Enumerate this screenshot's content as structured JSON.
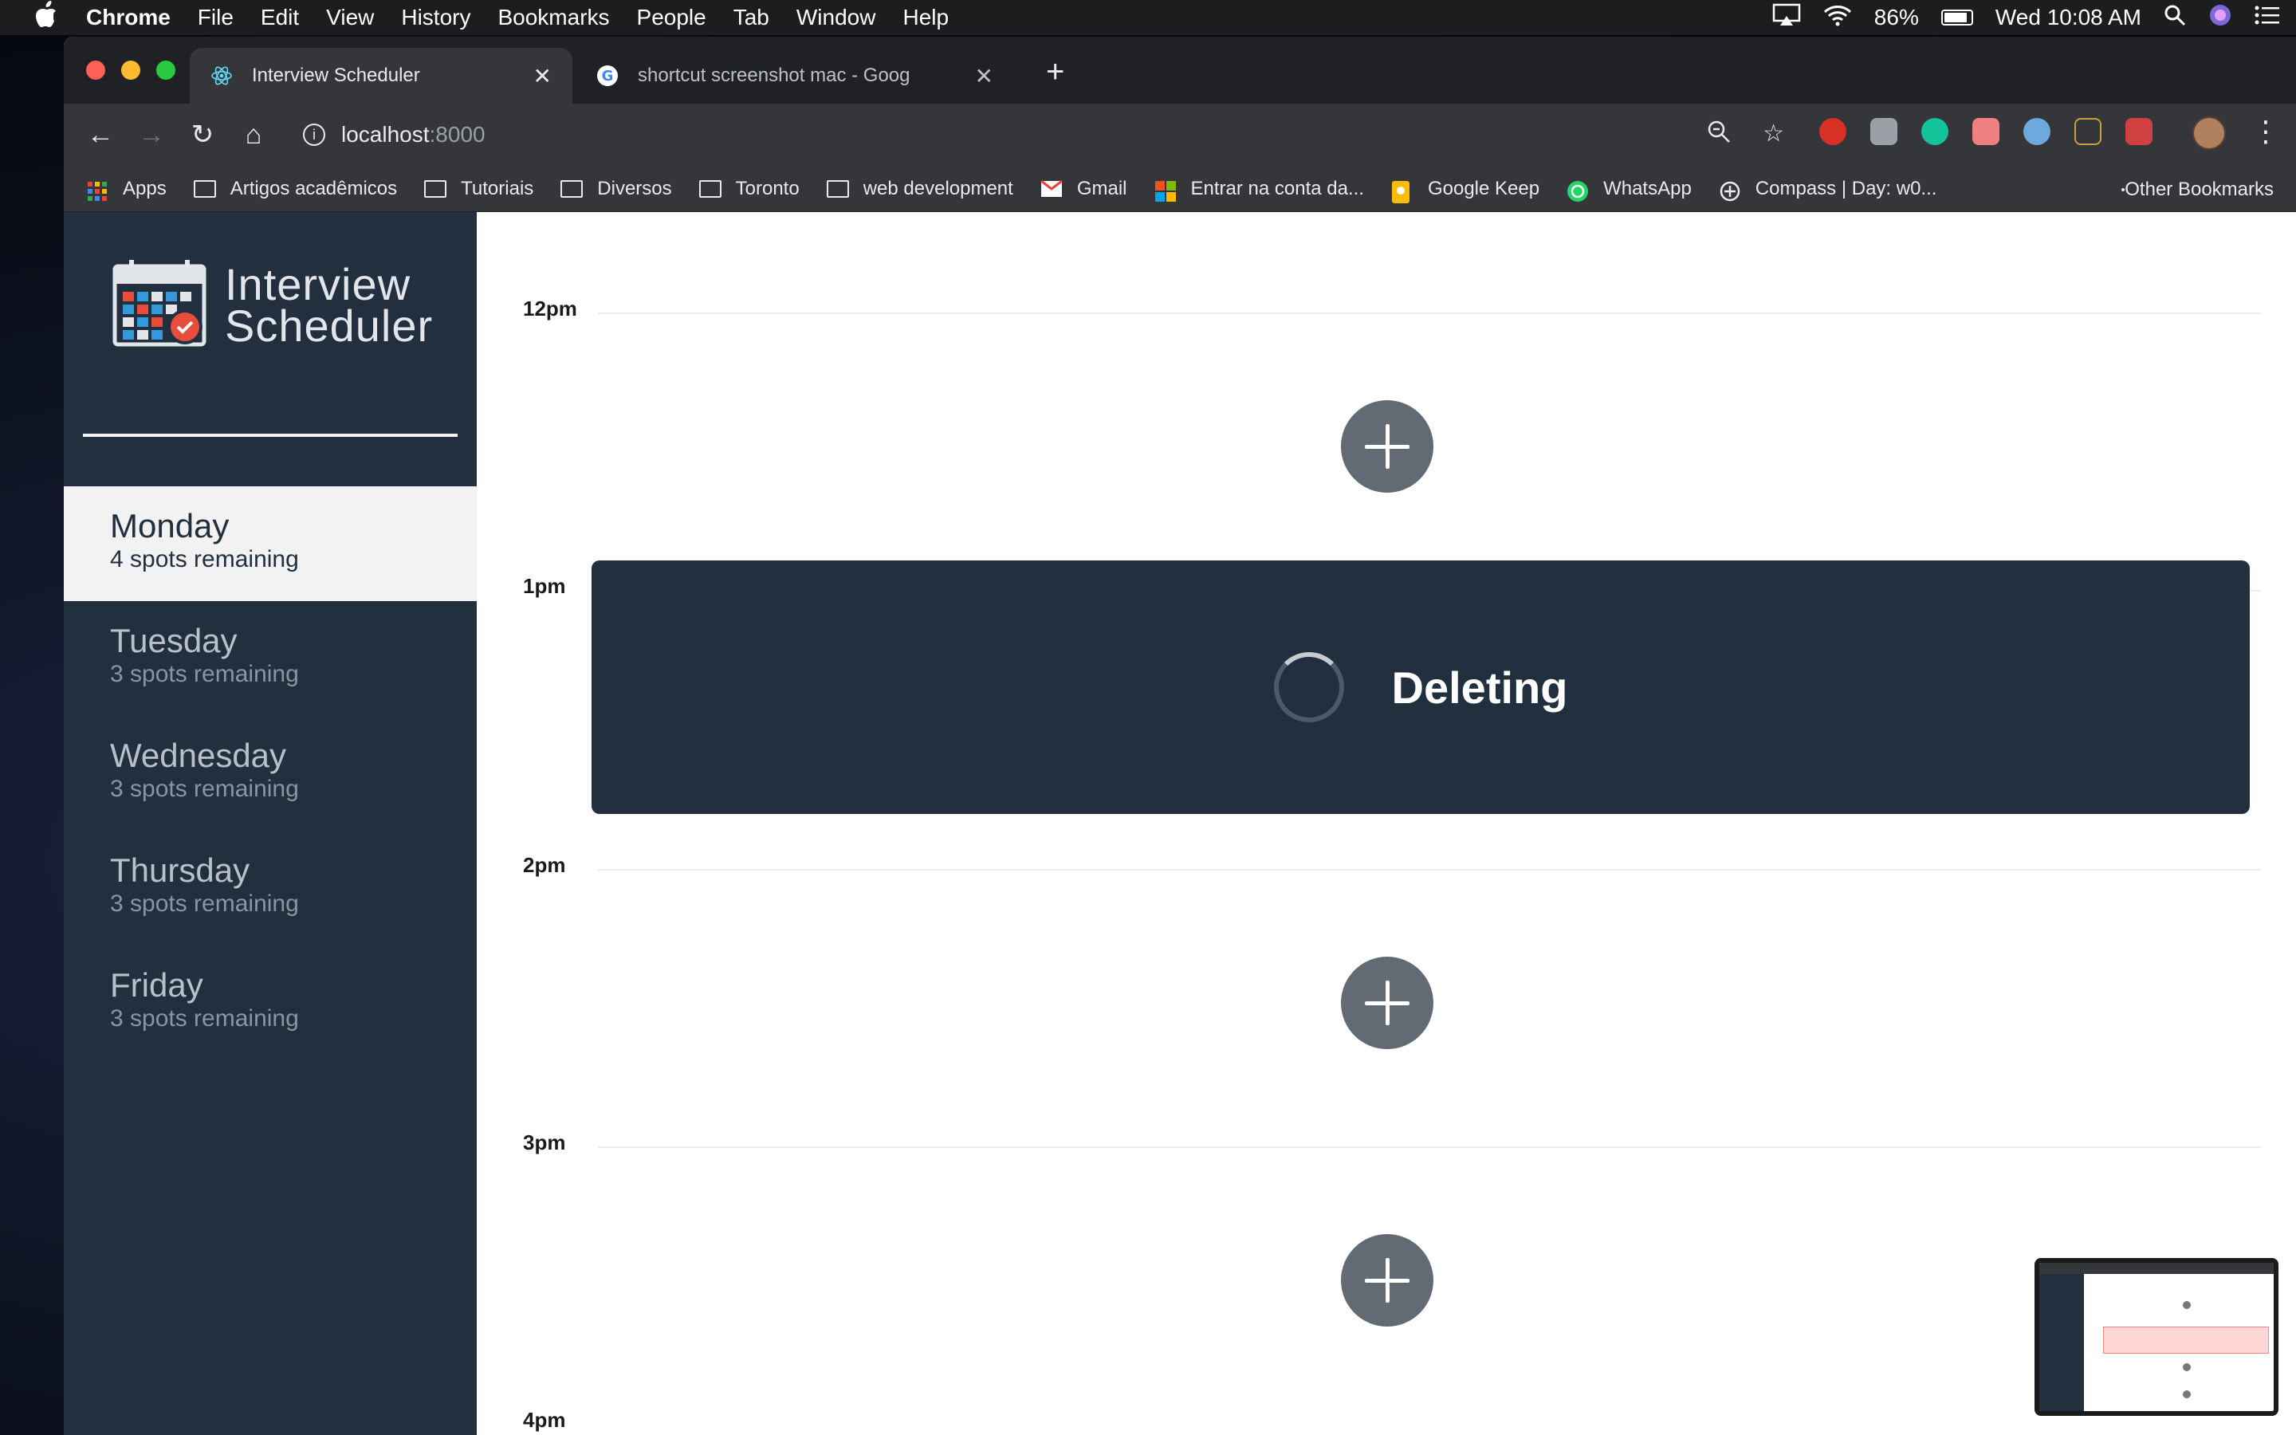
{
  "menubar": {
    "app_name": "Chrome",
    "items": [
      "File",
      "Edit",
      "View",
      "History",
      "Bookmarks",
      "People",
      "Tab",
      "Window",
      "Help"
    ],
    "battery": "86%",
    "clock": "Wed 10:08 AM"
  },
  "browser": {
    "tabs": [
      {
        "title": "Interview Scheduler",
        "active": true,
        "icon": "react-icon"
      },
      {
        "title": "shortcut screenshot mac - Goog",
        "active": false,
        "icon": "google-icon"
      }
    ],
    "url_host": "localhost",
    "url_port": ":8000",
    "bookmarks": [
      {
        "label": "Apps",
        "icon": "apps-grid-icon"
      },
      {
        "label": "Artigos acadêmicos",
        "icon": "folder-icon"
      },
      {
        "label": "Tutoriais",
        "icon": "folder-icon"
      },
      {
        "label": "Diversos",
        "icon": "folder-icon"
      },
      {
        "label": "Toronto",
        "icon": "folder-icon"
      },
      {
        "label": "web development",
        "icon": "folder-icon"
      },
      {
        "label": "Gmail",
        "icon": "gmail-icon"
      },
      {
        "label": "Entrar na conta da...",
        "icon": "microsoft-icon"
      },
      {
        "label": "Google Keep",
        "icon": "keep-icon"
      },
      {
        "label": "WhatsApp",
        "icon": "whatsapp-icon"
      },
      {
        "label": "Compass | Day: w0...",
        "icon": "compass-icon"
      }
    ],
    "other_bookmarks": "Other Bookmarks",
    "colors": {
      "tabbar": "#202124",
      "toolbar": "#35363a"
    }
  },
  "app": {
    "title_line1": "Interview",
    "title_line2": "Scheduler",
    "days": [
      {
        "name": "Monday",
        "spots": "4 spots remaining",
        "selected": true
      },
      {
        "name": "Tuesday",
        "spots": "3 spots remaining",
        "selected": false
      },
      {
        "name": "Wednesday",
        "spots": "3 spots remaining",
        "selected": false
      },
      {
        "name": "Thursday",
        "spots": "3 spots remaining",
        "selected": false
      },
      {
        "name": "Friday",
        "spots": "3 spots remaining",
        "selected": false
      }
    ],
    "hours": [
      "12pm",
      "1pm",
      "2pm",
      "3pm",
      "4pm"
    ],
    "deleting_status": "Deleting",
    "colors": {
      "sidebar": "#222f3e",
      "add_button": "#626a74",
      "selected_day": "#f2f2f2"
    }
  }
}
